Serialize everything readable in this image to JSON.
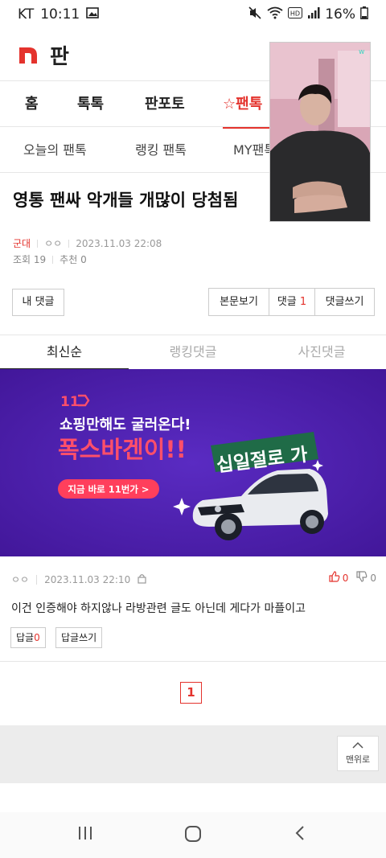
{
  "status": {
    "carrier": "KT",
    "time": "10:11",
    "battery": "16%"
  },
  "header": {
    "title": "판"
  },
  "main_tabs": [
    {
      "label": "홈"
    },
    {
      "label": "톡톡"
    },
    {
      "label": "판포토"
    },
    {
      "label": "☆팬톡",
      "active": true
    }
  ],
  "sub_tabs": [
    {
      "label": "오늘의 팬톡"
    },
    {
      "label": "랭킹 팬톡"
    },
    {
      "label": "MY팬톡"
    }
  ],
  "article": {
    "title": "영통 팬싸 악개들 개많이 당첨됨",
    "category": "군대",
    "author": "ㅇㅇ",
    "date": "2023.11.03 22:08",
    "views": "조회 19",
    "recommend": "추천 0"
  },
  "buttons": {
    "my_comments": "내 댓글",
    "view_post": "본문보기",
    "comments_label": "댓글",
    "comments_count": "1",
    "write_comment": "댓글쓰기"
  },
  "comment_tabs": [
    {
      "label": "최신순",
      "active": true
    },
    {
      "label": "랭킹댓글"
    },
    {
      "label": "사진댓글"
    }
  ],
  "ad": {
    "brand": "11",
    "line1": "쇼핑만해도 굴러온다!",
    "line2": "폭스바겐이!!",
    "button": "지금 바로 11번가 >",
    "sticker": "십일절로 가"
  },
  "comment": {
    "author": "ㅇㅇ",
    "date": "2023.11.03 22:10",
    "up": "0",
    "down": "0",
    "text": "이건 인증해야 하지않나 라방관련 글도 아닌데 게다가 마플이고",
    "reply_label": "답글",
    "reply_count": "0",
    "write_reply": "답글쓰기"
  },
  "pagination": {
    "current": "1"
  },
  "scroll_top": {
    "label": "맨위로"
  },
  "colors": {
    "accent": "#e4332d",
    "ad_bg": "#4b1fa8"
  }
}
